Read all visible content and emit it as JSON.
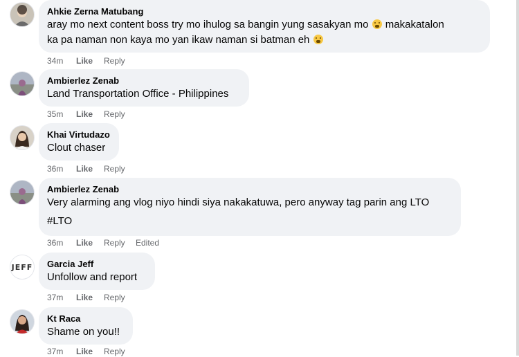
{
  "comments": [
    {
      "author": "Ahkie Zerna Matubang",
      "line1": "aray mo next content boss try mo ihulog sa bangin yung sasakyan mo",
      "line1b": "makakatalon",
      "line2": "ka pa naman non kaya mo yan ikaw naman si batman eh",
      "time": "34m",
      "like": "Like",
      "reply": "Reply"
    },
    {
      "author": "Ambierlez Zenab",
      "text": "Land Transportation Office - Philippines",
      "time": "35m",
      "like": "Like",
      "reply": "Reply"
    },
    {
      "author": "Khai Virtudazo",
      "text": "Clout chaser",
      "time": "36m",
      "like": "Like",
      "reply": "Reply"
    },
    {
      "author": "Ambierlez Zenab",
      "text": "Very alarming ang vlog niyo hindi siya nakakatuwa, pero anyway tag parin ang LTO",
      "text2": "#LTO",
      "time": "36m",
      "like": "Like",
      "reply": "Reply",
      "edited": "Edited"
    },
    {
      "author": "Garcia Jeff",
      "avatar_text": "JEFF",
      "text": "Unfollow and report",
      "time": "37m",
      "like": "Like",
      "reply": "Reply"
    },
    {
      "author": "Kt Raca",
      "text": "Shame on you!!",
      "time": "37m",
      "like": "Like",
      "reply": "Reply"
    }
  ],
  "icons": {
    "emoji": "astonished-face-emoji"
  },
  "colors": {
    "bubble": "#f0f2f5",
    "meta": "#65676b",
    "text": "#050505"
  }
}
